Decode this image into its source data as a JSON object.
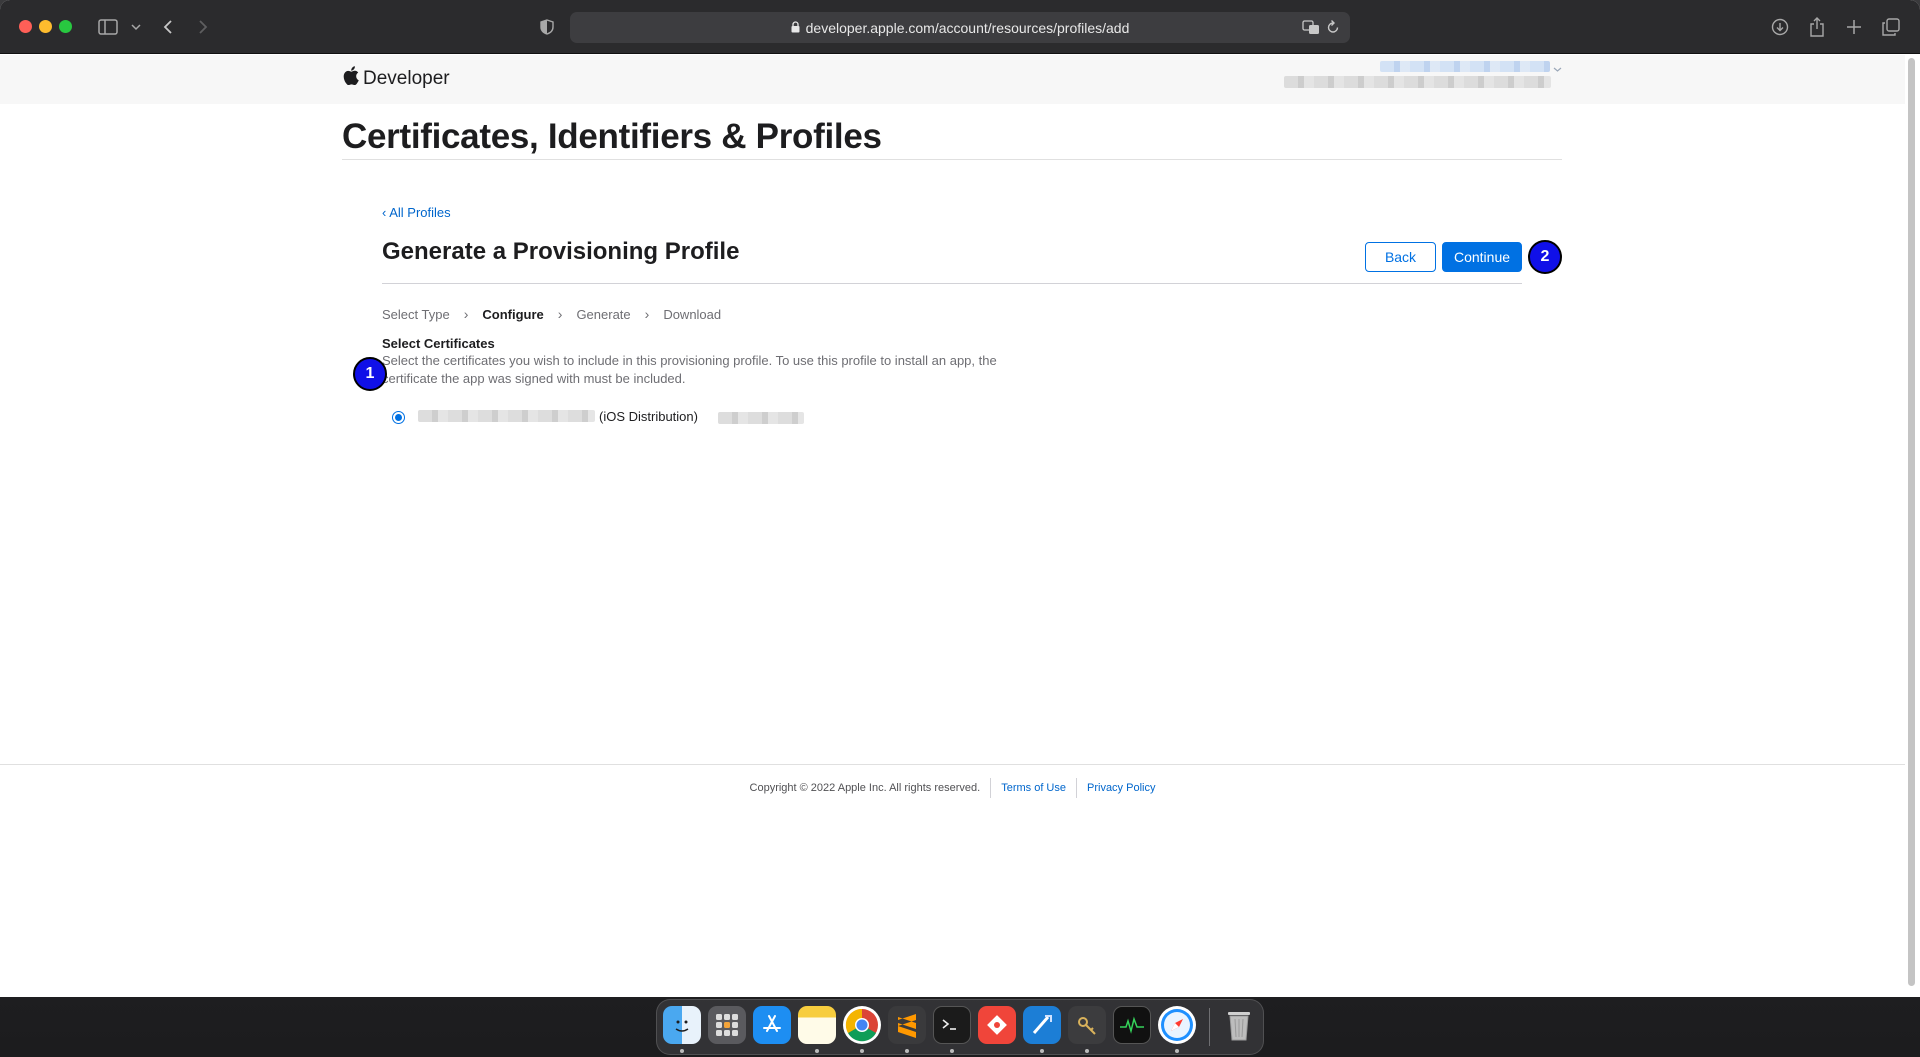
{
  "browser": {
    "url": "developer.apple.com/account/resources/profiles/add"
  },
  "nav": {
    "brand": "Developer"
  },
  "page": {
    "title": "Certificates, Identifiers & Profiles",
    "back_link": "‹ All Profiles",
    "section_title": "Generate a Provisioning Profile",
    "back_button": "Back",
    "continue_button": "Continue",
    "steps": [
      "Select Type",
      "Configure",
      "Generate",
      "Download"
    ],
    "active_step": "Configure",
    "subhead": "Select Certificates",
    "description": "Select the certificates you wish to include in this provisioning profile. To use this profile to install an app, the certificate the app was signed with must be included.",
    "certificates": [
      {
        "type": "(iOS Distribution)",
        "selected": true
      }
    ]
  },
  "badges": [
    "1",
    "2"
  ],
  "footer": {
    "copyright": "Copyright © 2022 Apple Inc. All rights reserved.",
    "terms": "Terms of Use",
    "privacy": "Privacy Policy"
  },
  "dock": {
    "apps": [
      "finder-icon",
      "launchpad-icon",
      "app-store-icon",
      "notes-icon",
      "chrome-icon",
      "sublime-text-icon",
      "terminal-icon",
      "git-client-icon",
      "xcode-icon",
      "keychain-icon",
      "activity-monitor-icon",
      "safari-icon",
      "trash-icon"
    ]
  },
  "colors": {
    "accent": "#0071e3",
    "link": "#0066cc",
    "badge": "#1010e8"
  }
}
